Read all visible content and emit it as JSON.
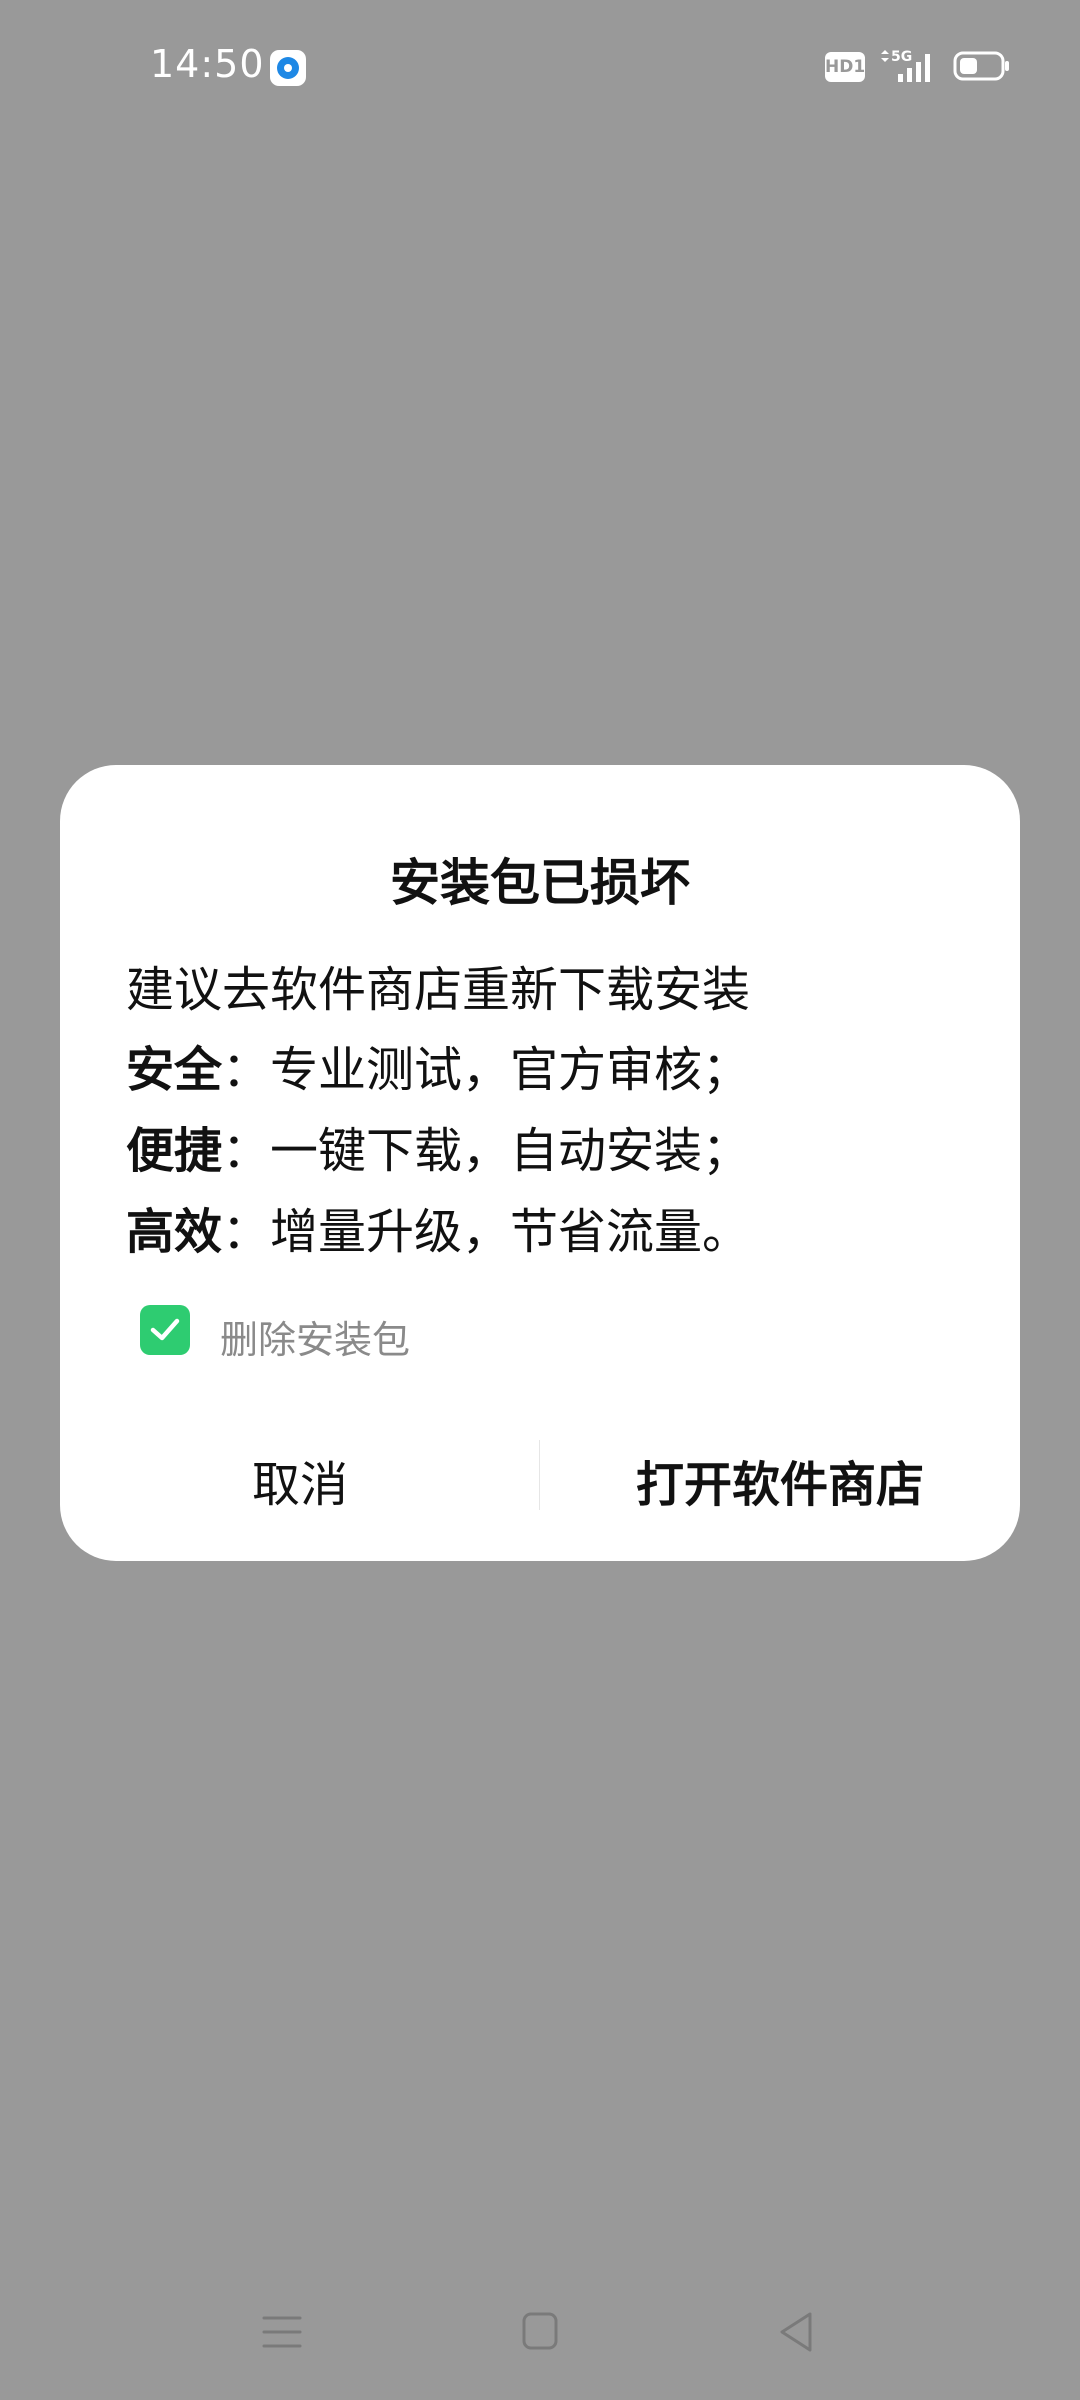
{
  "status_bar": {
    "time": "14:50",
    "hd_label": "HD1",
    "network": "5G",
    "app_icon": "app-notification-icon",
    "battery_icon": "battery-icon"
  },
  "dialog": {
    "title": "安装包已损坏",
    "lead": "建议去软件商店重新下载安装",
    "features": [
      {
        "label": "安全",
        "text": "：专业测试，官方审核；"
      },
      {
        "label": "便捷",
        "text": "：一键下载，自动安装；"
      },
      {
        "label": "高效",
        "text": "：增量升级，节省流量。"
      }
    ],
    "checkbox_label": "删除安装包",
    "checkbox_checked": true,
    "cancel_label": "取消",
    "open_label": "打开软件商店",
    "accent_color": "#2ecc71"
  },
  "nav_bar": {
    "menu_icon": "menu-icon",
    "home_icon": "home-icon",
    "back_icon": "back-icon"
  }
}
